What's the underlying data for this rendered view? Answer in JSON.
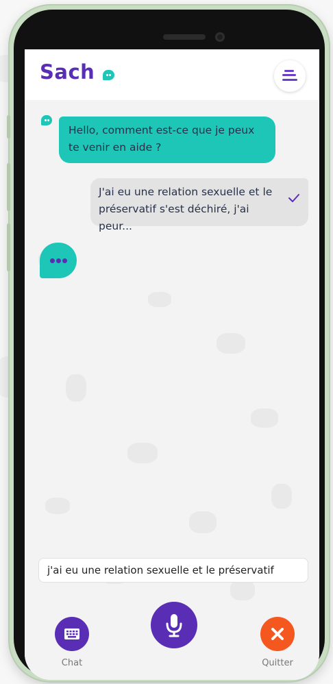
{
  "app": {
    "name": "Sacha",
    "logo_text": "Sach"
  },
  "header": {
    "menu_icon": "menu-icon"
  },
  "messages": [
    {
      "from": "bot",
      "text": "Hello, comment est-ce que je peux te venir en aide ?"
    },
    {
      "from": "user",
      "text": "J'ai eu une relation sexuelle et le préservatif s'est déchiré, j'ai peur...",
      "status_icon": "check-icon"
    }
  ],
  "typing_indicator": {
    "icon": "typing-dots-icon"
  },
  "input": {
    "value": "j'ai eu une relation sexuelle et le préservatif"
  },
  "bottom_bar": {
    "chat_label": "Chat",
    "quit_label": "Quitter",
    "chat_icon": "keyboard-icon",
    "mic_icon": "microphone-icon",
    "quit_icon": "close-icon"
  },
  "colors": {
    "brand_purple": "#5a2db5",
    "bot_teal": "#1ec6b8",
    "quit_orange": "#f4581f",
    "user_bubble": "#e3e3e3"
  }
}
